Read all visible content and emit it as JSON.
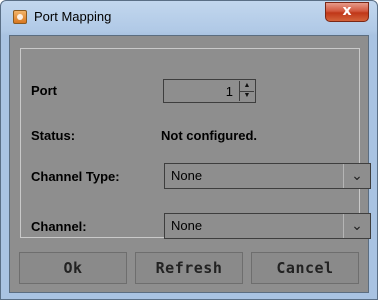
{
  "window": {
    "title": "Port Mapping",
    "close_label": "x",
    "icon": "java-cup-icon"
  },
  "form": {
    "port_label": "Port",
    "port_value": "1",
    "status_label": "Status:",
    "status_value": "Not configured.",
    "channel_type_label": "Channel Type:",
    "channel_type_value": "None",
    "channel_label": "Channel:",
    "channel_value": "None"
  },
  "buttons": {
    "ok": "Ok",
    "refresh": "Refresh",
    "cancel": "Cancel"
  },
  "colors": {
    "client_bg": "#8e8e8e",
    "titlebar": "#b0c9e6",
    "close_button": "#c8452a"
  }
}
